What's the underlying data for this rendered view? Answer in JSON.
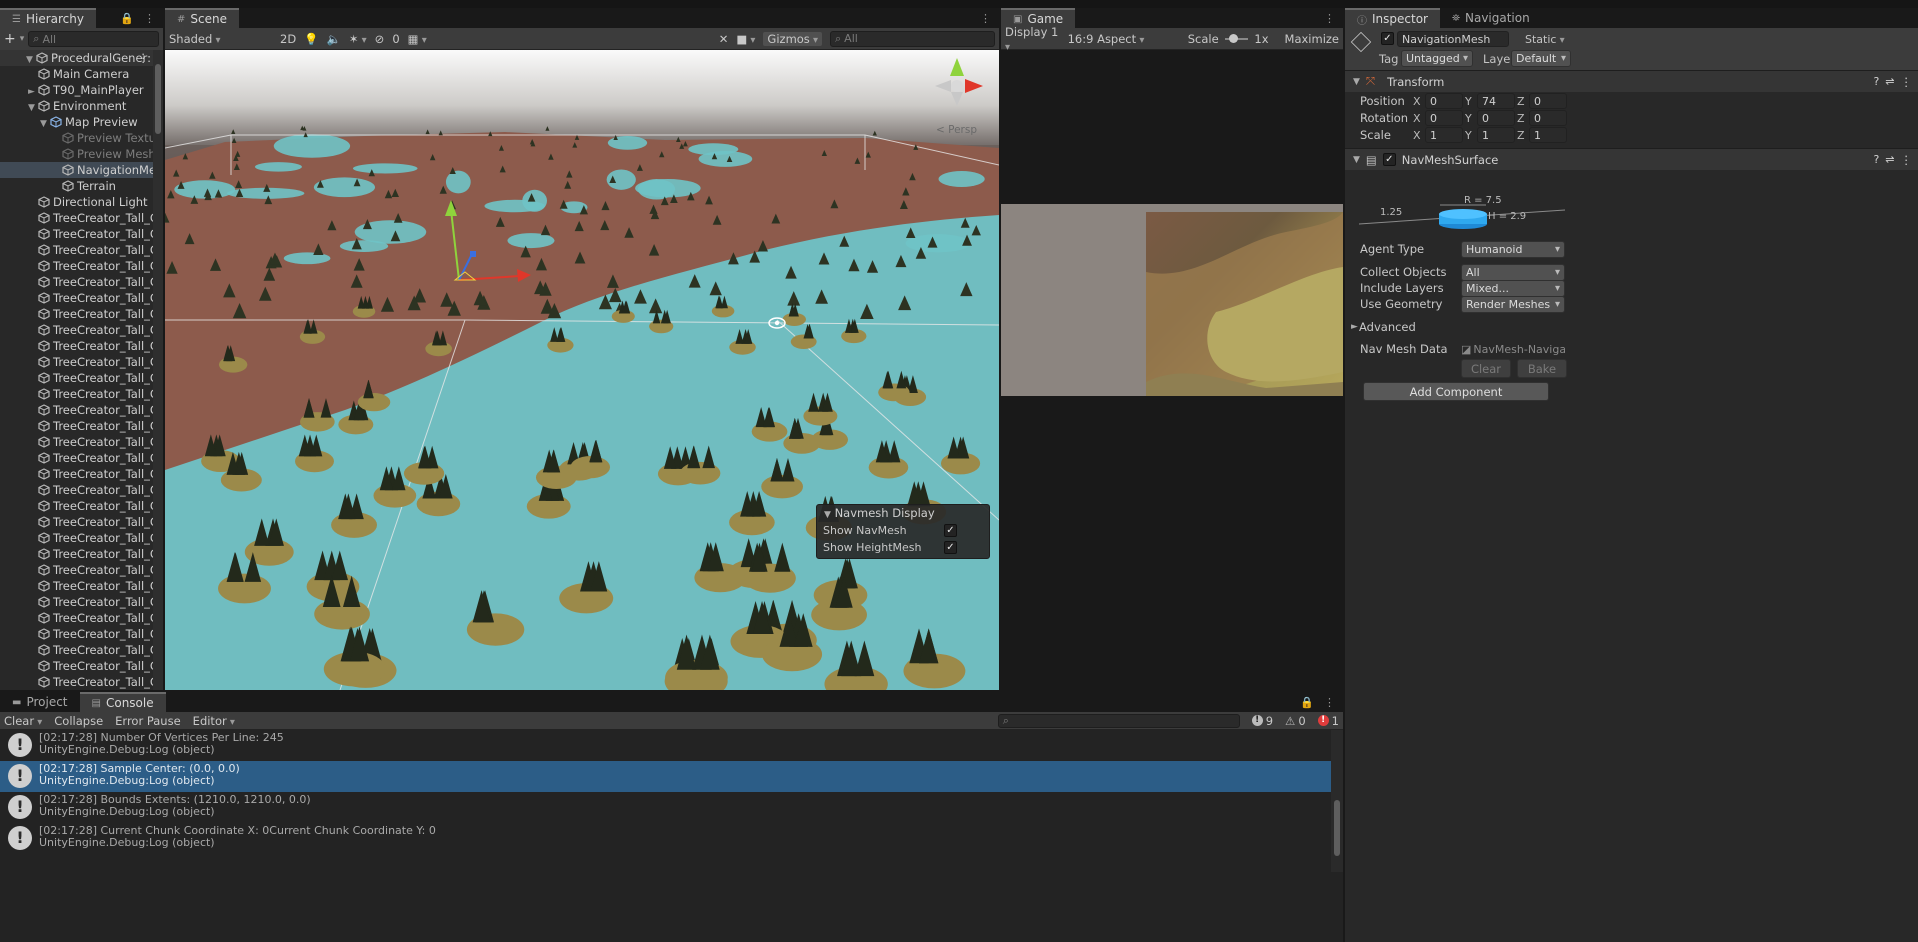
{
  "hierarchy": {
    "tab": "Hierarchy",
    "search_placeholder": "All",
    "items": [
      {
        "label": "ProceduralGener:",
        "indent": 0,
        "arrow": "▼",
        "kind": "scene"
      },
      {
        "label": "Main Camera",
        "indent": 1,
        "arrow": "",
        "kind": "go"
      },
      {
        "label": "T90_MainPlayer",
        "indent": 1,
        "arrow": "►",
        "kind": "go"
      },
      {
        "label": "Environment",
        "indent": 1,
        "arrow": "▼",
        "kind": "go"
      },
      {
        "label": "Map Preview",
        "indent": 2,
        "arrow": "▼",
        "kind": "prefab"
      },
      {
        "label": "Preview Textu",
        "indent": 3,
        "arrow": "",
        "kind": "go-dim"
      },
      {
        "label": "Preview Mesh",
        "indent": 3,
        "arrow": "",
        "kind": "go-dim"
      },
      {
        "label": "NavigationMe",
        "indent": 3,
        "arrow": "",
        "kind": "go-sel"
      },
      {
        "label": "Terrain",
        "indent": 3,
        "arrow": "",
        "kind": "go"
      },
      {
        "label": "Directional Light",
        "indent": 1,
        "arrow": "",
        "kind": "go"
      },
      {
        "label": "TreeCreator_Tall_C",
        "indent": 1,
        "arrow": "",
        "kind": "go"
      },
      {
        "label": "TreeCreator_Tall_C",
        "indent": 1,
        "arrow": "",
        "kind": "go"
      },
      {
        "label": "TreeCreator_Tall_C",
        "indent": 1,
        "arrow": "",
        "kind": "go"
      },
      {
        "label": "TreeCreator_Tall_C",
        "indent": 1,
        "arrow": "",
        "kind": "go"
      },
      {
        "label": "TreeCreator_Tall_C",
        "indent": 1,
        "arrow": "",
        "kind": "go"
      },
      {
        "label": "TreeCreator_Tall_C",
        "indent": 1,
        "arrow": "",
        "kind": "go"
      },
      {
        "label": "TreeCreator_Tall_C",
        "indent": 1,
        "arrow": "",
        "kind": "go"
      },
      {
        "label": "TreeCreator_Tall_C",
        "indent": 1,
        "arrow": "",
        "kind": "go"
      },
      {
        "label": "TreeCreator_Tall_C",
        "indent": 1,
        "arrow": "",
        "kind": "go"
      },
      {
        "label": "TreeCreator_Tall_C",
        "indent": 1,
        "arrow": "",
        "kind": "go"
      },
      {
        "label": "TreeCreator_Tall_C",
        "indent": 1,
        "arrow": "",
        "kind": "go"
      },
      {
        "label": "TreeCreator_Tall_C",
        "indent": 1,
        "arrow": "",
        "kind": "go"
      },
      {
        "label": "TreeCreator_Tall_C",
        "indent": 1,
        "arrow": "",
        "kind": "go"
      },
      {
        "label": "TreeCreator_Tall_C",
        "indent": 1,
        "arrow": "",
        "kind": "go"
      },
      {
        "label": "TreeCreator_Tall_C",
        "indent": 1,
        "arrow": "",
        "kind": "go"
      },
      {
        "label": "TreeCreator_Tall_C",
        "indent": 1,
        "arrow": "",
        "kind": "go"
      },
      {
        "label": "TreeCreator_Tall_C",
        "indent": 1,
        "arrow": "",
        "kind": "go"
      },
      {
        "label": "TreeCreator_Tall_C",
        "indent": 1,
        "arrow": "",
        "kind": "go"
      },
      {
        "label": "TreeCreator_Tall_C",
        "indent": 1,
        "arrow": "",
        "kind": "go"
      },
      {
        "label": "TreeCreator_Tall_C",
        "indent": 1,
        "arrow": "",
        "kind": "go"
      },
      {
        "label": "TreeCreator_Tall_C",
        "indent": 1,
        "arrow": "",
        "kind": "go"
      },
      {
        "label": "TreeCreator_Tall_C",
        "indent": 1,
        "arrow": "",
        "kind": "go"
      },
      {
        "label": "TreeCreator_Tall_C",
        "indent": 1,
        "arrow": "",
        "kind": "go"
      },
      {
        "label": "TreeCreator_Tall_C",
        "indent": 1,
        "arrow": "",
        "kind": "go"
      },
      {
        "label": "TreeCreator_Tall_C",
        "indent": 1,
        "arrow": "",
        "kind": "go"
      },
      {
        "label": "TreeCreator_Tall_C",
        "indent": 1,
        "arrow": "",
        "kind": "go"
      },
      {
        "label": "TreeCreator_Tall_C",
        "indent": 1,
        "arrow": "",
        "kind": "go"
      },
      {
        "label": "TreeCreator_Tall_C",
        "indent": 1,
        "arrow": "",
        "kind": "go"
      },
      {
        "label": "TreeCreator_Tall_C",
        "indent": 1,
        "arrow": "",
        "kind": "go"
      },
      {
        "label": "TreeCreator_Tall_C",
        "indent": 1,
        "arrow": "",
        "kind": "go"
      },
      {
        "label": "TreeCreator_Tall_C",
        "indent": 1,
        "arrow": "",
        "kind": "go"
      },
      {
        "label": "TreeCreator_Tall_C",
        "indent": 1,
        "arrow": "",
        "kind": "go"
      },
      {
        "label": "TreeCreator_Tall_C",
        "indent": 1,
        "arrow": "",
        "kind": "go"
      }
    ]
  },
  "scene": {
    "tab": "Scene",
    "shading": "Shaded",
    "mode_2d": "2D",
    "hidden_count": "0",
    "gizmos": "Gizmos",
    "search_placeholder": "All",
    "persp": "< Persp",
    "navmesh_overlay": {
      "title": "Navmesh Display",
      "options": [
        {
          "label": "Show NavMesh",
          "checked": true
        },
        {
          "label": "Show HeightMesh",
          "checked": true
        }
      ]
    }
  },
  "game": {
    "tab": "Game",
    "display": "Display 1",
    "aspect": "16:9 Aspect",
    "scale_label": "Scale",
    "scale_value": "1x",
    "maximize": "Maximize"
  },
  "inspector": {
    "tabs": [
      "Inspector",
      "Navigation"
    ],
    "object_name": "NavigationMesh",
    "static_label": "Static",
    "tag_label": "Tag",
    "tag_value": "Untagged",
    "layer_label": "Layer",
    "layer_value": "Default",
    "transform": {
      "title": "Transform",
      "position_label": "Position",
      "rotation_label": "Rotation",
      "scale_label": "Scale",
      "position": {
        "x": "0",
        "y": "74",
        "z": "0"
      },
      "rotation": {
        "x": "0",
        "y": "0",
        "z": "0"
      },
      "scale": {
        "x": "1",
        "y": "1",
        "z": "1"
      }
    },
    "navmesh_surface": {
      "title": "NavMeshSurface",
      "agent_r": "R = 7.5",
      "agent_h": "H = 2.9",
      "agent_step": "1.25",
      "agent_type_label": "Agent Type",
      "agent_type_value": "Humanoid",
      "collect_label": "Collect Objects",
      "collect_value": "All",
      "include_label": "Include Layers",
      "include_value": "Mixed...",
      "geometry_label": "Use Geometry",
      "geometry_value": "Render Meshes",
      "advanced_label": "Advanced",
      "data_label": "Nav Mesh Data",
      "data_value": "NavMesh-Navigat",
      "clear_button": "Clear",
      "bake_button": "Bake"
    },
    "add_component": "Add Component"
  },
  "bottom": {
    "tabs": [
      "Project",
      "Console"
    ],
    "toolbar": {
      "clear": "Clear",
      "collapse": "Collapse",
      "error_pause": "Error Pause",
      "editor": "Editor"
    },
    "counts": {
      "logs": "9",
      "warnings": "0",
      "errors": "1"
    },
    "logs": [
      {
        "line1": "[02:17:28] Number Of Vertices Per Line: 245",
        "line2": "UnityEngine.Debug:Log (object)"
      },
      {
        "line1": "[02:17:28] Sample Center: (0.0, 0.0)",
        "line2": "UnityEngine.Debug:Log (object)"
      },
      {
        "line1": "[02:17:28] Bounds Extents: (1210.0, 1210.0, 0.0)",
        "line2": "UnityEngine.Debug:Log (object)"
      },
      {
        "line1": "[02:17:28] Current Chunk Coordinate X: 0Current Chunk Coordinate Y: 0",
        "line2": "UnityEngine.Debug:Log (object)"
      }
    ]
  },
  "colors": {
    "navmesh": "#6fc3c6",
    "terrain": "#8d5b4c",
    "island": "#9b8a4a",
    "selection": "#2c5d87",
    "axis_x": "#e0372a",
    "axis_y": "#8fd33c",
    "axis_z": "#3a6fe0"
  }
}
